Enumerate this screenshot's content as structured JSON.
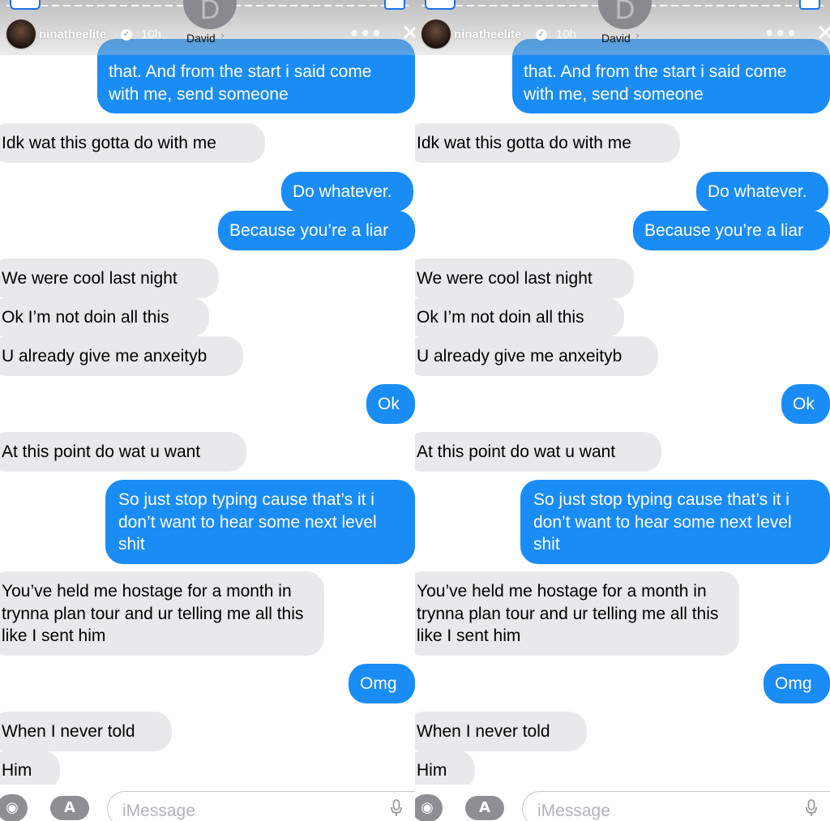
{
  "header": {
    "story_user": "ninatheelite",
    "story_time": "10h",
    "contact_name": "David",
    "contact_initial": "D",
    "more_glyph": "•••",
    "close_glyph": "✕",
    "verified_glyph": "✓",
    "chevron_glyph": "›"
  },
  "messages": {
    "partial_top": "that. And from the start i said come with me, send someone",
    "m1": "Idk wat this gotta do with me",
    "m2": "Do whatever.",
    "m3": "Because you’re a liar",
    "m4": "We were cool last night",
    "m5": "Ok I’m not doin all this",
    "m6": "U already give me anxeityb",
    "m7": "Ok",
    "m8": "At this point do wat u want",
    "m9": "So just stop typing cause that’s it i don’t want to hear some next level shit",
    "m10": "You’ve held me hostage for a month in trynna plan tour and ur telling me all this like I sent him",
    "m11": "Omg",
    "m12": "When I never told",
    "m13": "Him"
  },
  "composer": {
    "placeholder": "iMessage",
    "camera_glyph": "◉",
    "appstore_glyph": "A"
  },
  "colors": {
    "outgoing_bubble": "#1a8cf5",
    "incoming_bubble": "#e9e9eb"
  },
  "icons": [
    "verified-icon",
    "chevron-right-icon",
    "more-icon",
    "close-icon",
    "camera-icon",
    "appstore-icon",
    "mic-icon"
  ]
}
